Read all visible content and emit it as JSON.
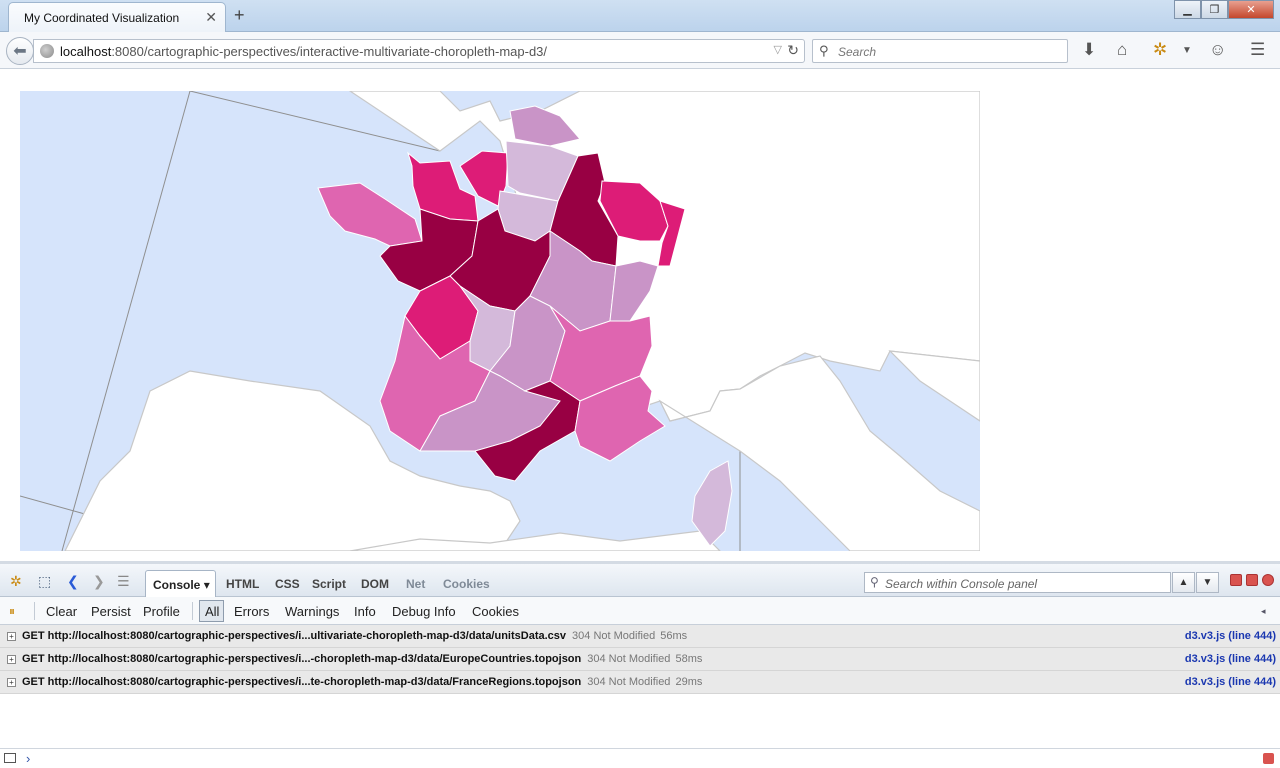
{
  "browser": {
    "tab_title": "My Coordinated Visualization",
    "url_host": "localhost",
    "url_rest": ":8080/cartographic-perspectives/interactive-multivariate-choropleth-map-d3/",
    "search_placeholder": "Search"
  },
  "map": {
    "regions": [
      {
        "name": "Bretagne",
        "color": "#df65b0"
      },
      {
        "name": "Basse-Normandie",
        "color": "#dd1c77"
      },
      {
        "name": "Haute-Normandie",
        "color": "#dd1c77"
      },
      {
        "name": "Nord-Pas-de-Calais",
        "color": "#c994c7"
      },
      {
        "name": "Picardie",
        "color": "#d4b9da"
      },
      {
        "name": "Ile-de-France",
        "color": "#d4b9da"
      },
      {
        "name": "Champagne-Ardenne",
        "color": "#980043"
      },
      {
        "name": "Lorraine",
        "color": "#dd1c77"
      },
      {
        "name": "Alsace",
        "color": "#dd1c77"
      },
      {
        "name": "Pays de la Loire",
        "color": "#980043"
      },
      {
        "name": "Centre",
        "color": "#980043"
      },
      {
        "name": "Bourgogne",
        "color": "#c994c7"
      },
      {
        "name": "Franche-Comte",
        "color": "#c994c7"
      },
      {
        "name": "Poitou-Charentes",
        "color": "#dd1c77"
      },
      {
        "name": "Limousin",
        "color": "#d4b9da"
      },
      {
        "name": "Auvergne",
        "color": "#c994c7"
      },
      {
        "name": "Rhone-Alpes",
        "color": "#df65b0"
      },
      {
        "name": "Aquitaine",
        "color": "#df65b0"
      },
      {
        "name": "Midi-Pyrenees",
        "color": "#c994c7"
      },
      {
        "name": "Languedoc-Roussillon",
        "color": "#980043"
      },
      {
        "name": "Provence-Alpes-Cote d'Azur",
        "color": "#df65b0"
      },
      {
        "name": "Corse",
        "color": "#d4b9da"
      }
    ],
    "sea_color": "#d6e4fb",
    "land_color": "#ffffff",
    "border_color": "#c8c8c8"
  },
  "firebug": {
    "tabs": [
      "Console",
      "HTML",
      "CSS",
      "Script",
      "DOM",
      "Net",
      "Cookies"
    ],
    "search_placeholder": "Search within Console panel",
    "filters": [
      "Clear",
      "Persist",
      "Profile",
      "All",
      "Errors",
      "Warnings",
      "Info",
      "Debug Info",
      "Cookies"
    ],
    "logs": [
      {
        "request": "GET http://localhost:8080/cartographic-perspectives/i...ultivariate-choropleth-map-d3/data/unitsData.csv",
        "status": "304 Not Modified",
        "time": "56ms",
        "source": "d3.v3.js (line 444)"
      },
      {
        "request": "GET http://localhost:8080/cartographic-perspectives/i...-choropleth-map-d3/data/EuropeCountries.topojson",
        "status": "304 Not Modified",
        "time": "58ms",
        "source": "d3.v3.js (line 444)"
      },
      {
        "request": "GET http://localhost:8080/cartographic-perspectives/i...te-choropleth-map-d3/data/FranceRegions.topojson",
        "status": "304 Not Modified",
        "time": "29ms",
        "source": "d3.v3.js (line 444)"
      }
    ],
    "prompt": "›"
  }
}
